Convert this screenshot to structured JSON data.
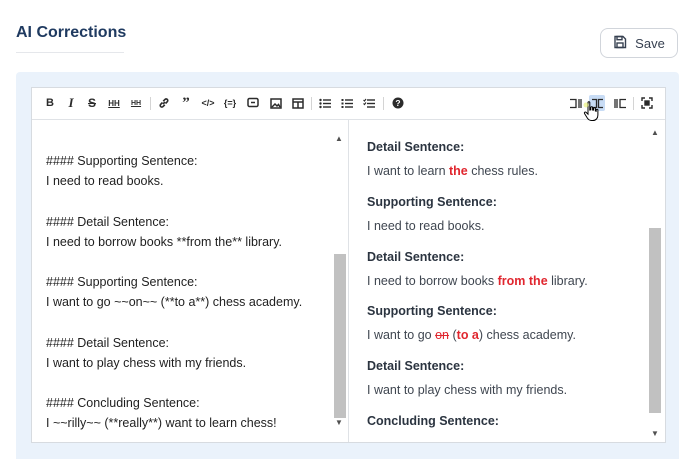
{
  "page": {
    "title": "AI Corrections"
  },
  "save_button": {
    "label": "Save",
    "icon": "floppy-disk-icon"
  },
  "toolbar": {
    "left_tools": [
      "bold-icon",
      "italic-icon",
      "strikethrough-icon",
      "heading-icon",
      "heading-smaller-icon",
      "link-icon",
      "quote-icon",
      "code-icon",
      "code-block-icon",
      "comment-icon",
      "image-icon",
      "table-icon",
      "unordered-list-icon",
      "ordered-list-icon",
      "checklist-icon",
      "help-icon"
    ],
    "right_tools": [
      "editor-only-icon",
      "side-by-side-icon",
      "preview-only-icon",
      "fullscreen-icon"
    ],
    "active_tool": "side-by-side-icon"
  },
  "source_lines": [
    "#### Supporting Sentence:",
    "I need to read books.",
    "#### Detail Sentence:",
    "I need to borrow books **from the** library.",
    "#### Supporting Sentence:",
    "I want to go ~~on~~ (**to a**) chess academy.",
    "#### Detail Sentence:",
    "I want to play chess with my friends.",
    "#### Concluding Sentence:",
    "I ~~rilly~~ (**really**) want to learn chess!"
  ],
  "preview": {
    "headings": [
      "Detail Sentence:",
      "Supporting Sentence:",
      "Detail Sentence:",
      "Supporting Sentence:",
      "Detail Sentence:",
      "Concluding Sentence:"
    ],
    "p1_pre": "I want to learn ",
    "p1_hl": "the",
    "p1_post": " chess rules.",
    "p2": "I need to read books.",
    "p3_pre": "I need to borrow books ",
    "p3_hl": "from the",
    "p3_post": " library.",
    "p4_pre": "I want to go ",
    "p4_strike": "on",
    "p4_open": " (",
    "p4_hl": "to a",
    "p4_close": ") chess academy.",
    "p5": "I want to play chess with my friends."
  },
  "colors": {
    "highlight": "#e0262e",
    "title": "#1f3a60",
    "panel": "#eaf2fb"
  }
}
